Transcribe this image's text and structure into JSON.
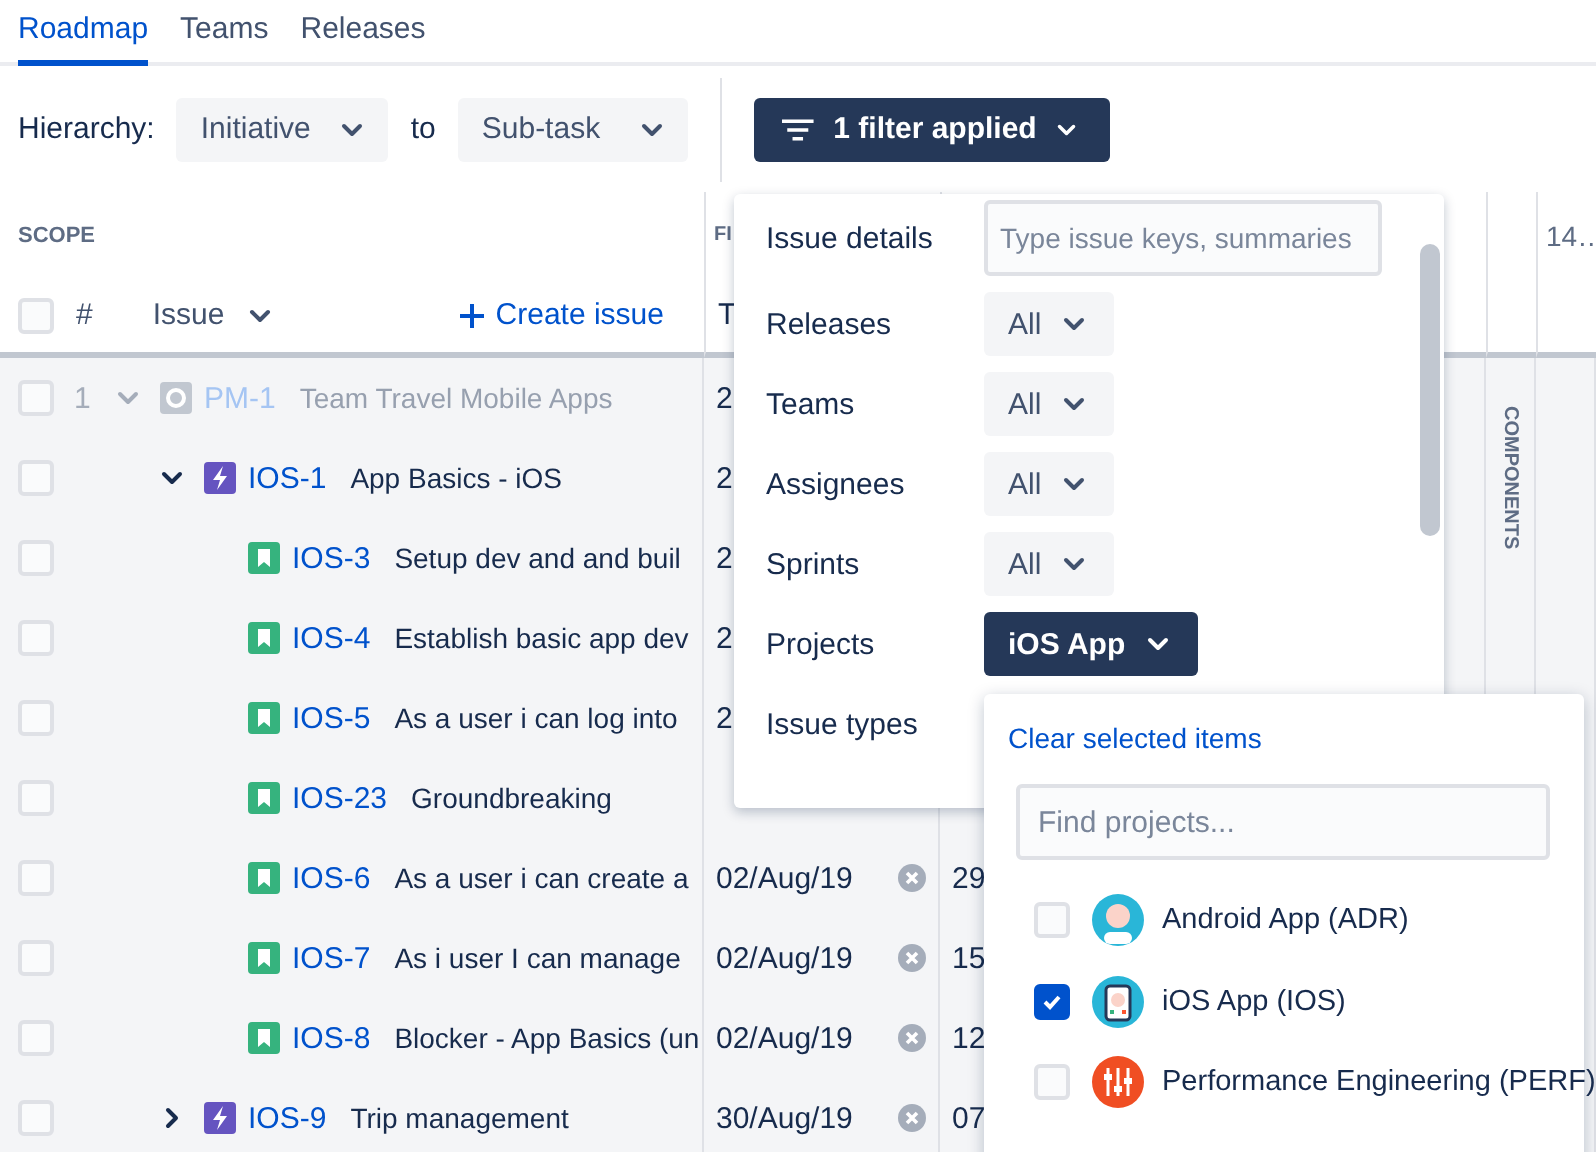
{
  "tabs": [
    {
      "label": "Roadmap",
      "selected": true
    },
    {
      "label": "Teams",
      "selected": false
    },
    {
      "label": "Releases",
      "selected": false
    }
  ],
  "hierarchy": {
    "label": "Hierarchy:",
    "from": "Initiative",
    "joiner": "to",
    "to": "Sub-task"
  },
  "filter_button": {
    "label": "1 filter applied"
  },
  "scope": {
    "title": "SCOPE",
    "all_checked": false,
    "number_header": "#",
    "issue_header": "Issue",
    "create_label": "Create issue"
  },
  "field_headers": {
    "group": "FI",
    "date": "T",
    "timeline": "14…",
    "components": "COMPONENTS"
  },
  "rows": [
    {
      "number": "1",
      "key": "PM-1",
      "summary": "Team Travel Mobile Apps",
      "kind": "initiative",
      "faded": true,
      "checked": false,
      "expanded": true,
      "date": "2",
      "children": [
        {
          "key": "IOS-1",
          "summary": "App Basics - iOS",
          "kind": "epic",
          "faded": false,
          "checked": false,
          "expanded": true,
          "date": "2",
          "children": [
            {
              "key": "IOS-3",
              "summary": "Setup dev and and buil",
              "kind": "story",
              "faded": false,
              "checked": false,
              "date": "2"
            },
            {
              "key": "IOS-4",
              "summary": "Establish basic app dev",
              "kind": "story",
              "faded": false,
              "checked": false,
              "date": "2"
            },
            {
              "key": "IOS-5",
              "summary": "As a user i can log into",
              "kind": "story",
              "faded": false,
              "checked": false,
              "date": "2"
            },
            {
              "key": "IOS-23",
              "summary": "Groundbreaking",
              "kind": "story",
              "faded": false,
              "checked": false
            },
            {
              "key": "IOS-6",
              "summary": "As a user i can create a",
              "kind": "story",
              "faded": false,
              "checked": false,
              "date": "02/Aug/19",
              "value": "29"
            },
            {
              "key": "IOS-7",
              "summary": "As i user I can manage",
              "kind": "story",
              "faded": false,
              "checked": false,
              "date": "02/Aug/19",
              "value": "15"
            },
            {
              "key": "IOS-8",
              "summary": "Blocker - App Basics (un",
              "kind": "story",
              "faded": false,
              "checked": false,
              "date": "02/Aug/19",
              "value": "12"
            }
          ]
        },
        {
          "key": "IOS-9",
          "summary": "Trip management",
          "kind": "epic",
          "faded": false,
          "checked": false,
          "expanded": false,
          "date": "30/Aug/19",
          "value": "07"
        }
      ]
    }
  ],
  "filters": [
    {
      "label": "Issue details",
      "kind": "text",
      "placeholder": "Type issue keys, summaries"
    },
    {
      "label": "Releases",
      "kind": "select",
      "value": "All",
      "active": false
    },
    {
      "label": "Teams",
      "kind": "select",
      "value": "All",
      "active": false
    },
    {
      "label": "Assignees",
      "kind": "select",
      "value": "All",
      "active": false
    },
    {
      "label": "Sprints",
      "kind": "select",
      "value": "All",
      "active": false
    },
    {
      "label": "Projects",
      "kind": "select",
      "value": "iOS App",
      "active": true
    },
    {
      "label": "Issue types",
      "kind": "label"
    }
  ],
  "projects_menu": {
    "clear": "Clear selected items",
    "placeholder": "Find projects...",
    "items": [
      {
        "name": "Android App (ADR)",
        "checked": false,
        "kind": "person",
        "color": "#29b6d8"
      },
      {
        "name": "iOS App (IOS)",
        "checked": true,
        "kind": "phone",
        "color": "#29b6d8"
      },
      {
        "name": "Performance Engineering (PERF)",
        "checked": false,
        "kind": "sliders",
        "color": "#f04e23"
      }
    ]
  }
}
